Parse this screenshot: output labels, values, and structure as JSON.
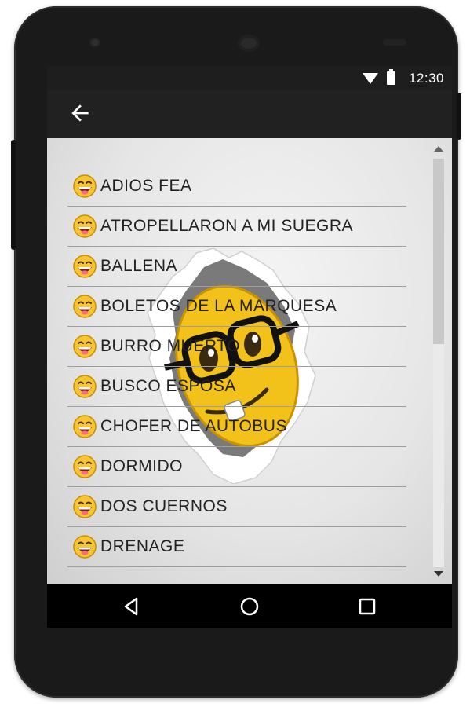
{
  "status_bar": {
    "time": "12:30",
    "icons": [
      "wifi-icon",
      "battery-icon"
    ]
  },
  "app_bar": {
    "back_icon": "arrow-left-icon"
  },
  "list": {
    "item_icon": "laughing-face-icon",
    "items": [
      {
        "label": "ADIOS FEA"
      },
      {
        "label": "ATROPELLARON A MI SUEGRA"
      },
      {
        "label": "BALLENA"
      },
      {
        "label": "BOLETOS DE LA MARQUESA"
      },
      {
        "label": "BURRO MUERTO"
      },
      {
        "label": "BUSCO ESPOSA"
      },
      {
        "label": "CHOFER DE AUTOBUS"
      },
      {
        "label": "DORMIDO"
      },
      {
        "label": "DOS CUERNOS"
      },
      {
        "label": "DRENAGE"
      }
    ]
  },
  "background_art": "nerd-emoji-through-torn-paper",
  "nav_bar": {
    "buttons": [
      "back-triangle-icon",
      "home-circle-icon",
      "recents-square-icon"
    ]
  },
  "colors": {
    "status_bar": "#1e1e1e",
    "app_bar": "#212121",
    "divider": "#9e9e9e",
    "emoji_yellow": "#f2c21b"
  }
}
